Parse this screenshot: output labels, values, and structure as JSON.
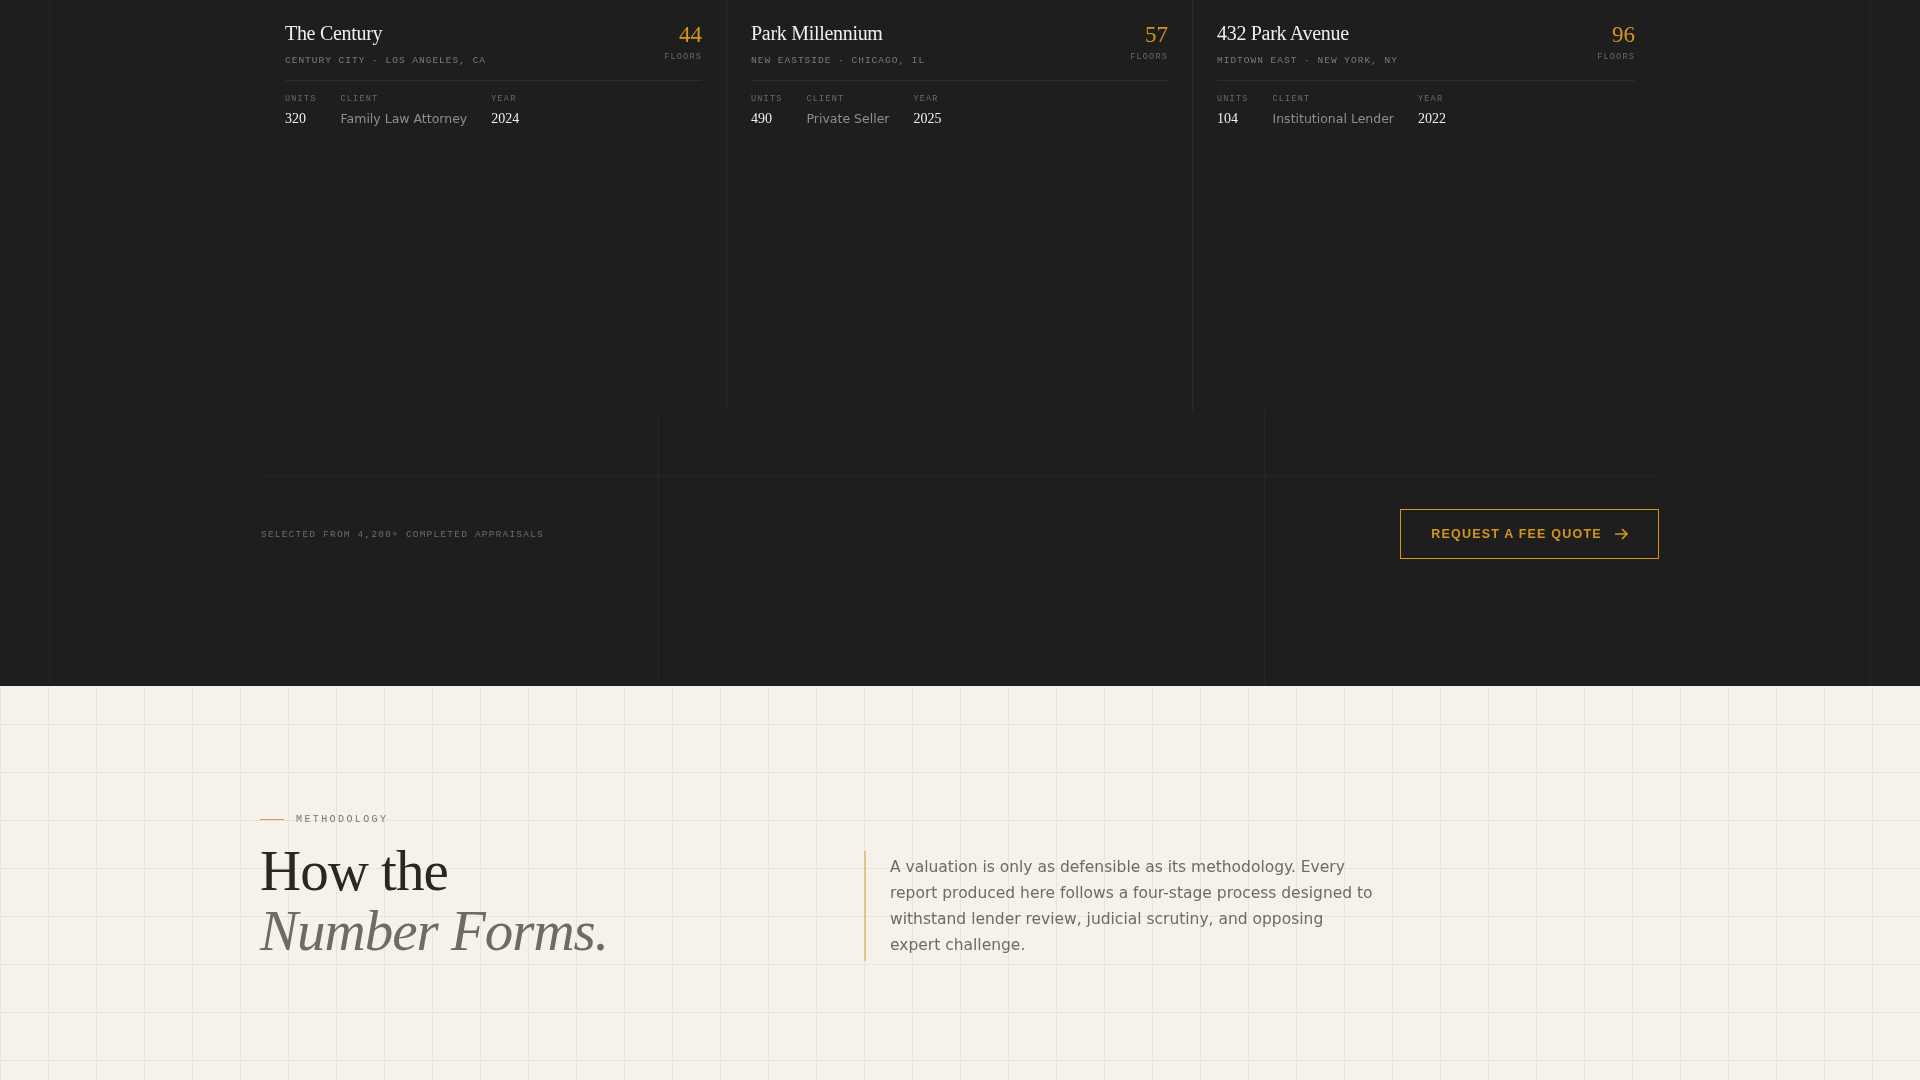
{
  "projects": [
    {
      "name": "The Century",
      "location": "CENTURY CITY · LOS ANGELES, CA",
      "floors": "44",
      "floors_label": "FLOORS",
      "stats": [
        {
          "label": "UNITS",
          "value": "320",
          "kind": "number"
        },
        {
          "label": "CLIENT",
          "value": "Family Law Attorney",
          "kind": "text"
        },
        {
          "label": "YEAR",
          "value": "2024",
          "kind": "number"
        }
      ]
    },
    {
      "name": "Park Millennium",
      "location": "NEW EASTSIDE · CHICAGO, IL",
      "floors": "57",
      "floors_label": "FLOORS",
      "stats": [
        {
          "label": "UNITS",
          "value": "490",
          "kind": "number"
        },
        {
          "label": "CLIENT",
          "value": "Private Seller",
          "kind": "text"
        },
        {
          "label": "YEAR",
          "value": "2025",
          "kind": "number"
        }
      ]
    },
    {
      "name": "432 Park Avenue",
      "location": "MIDTOWN EAST · NEW YORK, NY",
      "floors": "96",
      "floors_label": "FLOORS",
      "stats": [
        {
          "label": "UNITS",
          "value": "104",
          "kind": "number"
        },
        {
          "label": "CLIENT",
          "value": "Institutional Lender",
          "kind": "text"
        },
        {
          "label": "YEAR",
          "value": "2022",
          "kind": "number"
        }
      ]
    }
  ],
  "footer": {
    "note": "SELECTED FROM 4,200+ COMPLETED APPRAISALS",
    "button": "REQUEST A FEE QUOTE"
  },
  "methodology": {
    "eyebrow": "METHODOLOGY",
    "heading_line_1": "How the",
    "heading_line_2": "Number Forms.",
    "intro": "A valuation is only as defensible as its methodology. Every report produced here follows a four-stage process designed to withstand lender review, judicial scrutiny, and opposing expert challenge."
  }
}
